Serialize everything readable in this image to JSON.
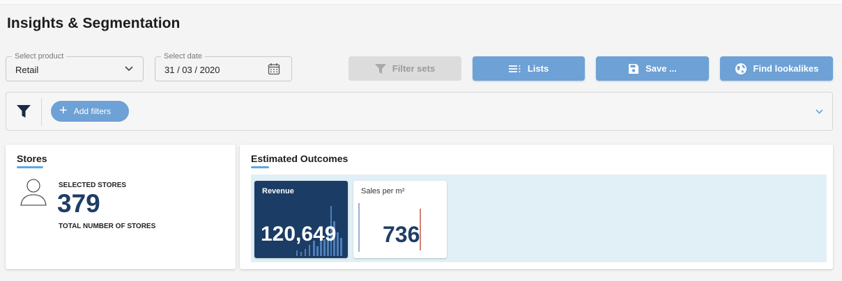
{
  "page": {
    "title": "Insights & Segmentation"
  },
  "controls": {
    "product": {
      "label": "Select product",
      "value": "Retail"
    },
    "date": {
      "label": "Select date",
      "value": "31 / 03 / 2020"
    }
  },
  "toolbar": {
    "filter_sets_label": "Filter sets",
    "lists_label": "Lists",
    "save_label": "Save ...",
    "find_lookalikes_label": "Find lookalikes"
  },
  "filters": {
    "add_label": "Add filters"
  },
  "stores": {
    "title": "Stores",
    "selected_label": "SELECTED STORES",
    "count": "379",
    "total_label": "TOTAL NUMBER OF STORES"
  },
  "outcomes": {
    "title": "Estimated Outcomes",
    "tiles": [
      {
        "label": "Revenue",
        "value": "120,649"
      },
      {
        "label": "Sales per m²",
        "value": "736"
      }
    ]
  },
  "icons": {
    "filter": "filter-icon",
    "calendar": "calendar-icon",
    "chevron": "chevron-down-icon",
    "list": "list-icon",
    "save": "save-icon",
    "globe": "globe-icon",
    "user": "user-icon",
    "plus": "plus-icon"
  },
  "colors": {
    "accent": "#6ea1d6",
    "dark_tile": "#1b3c64",
    "number": "#1e3d66",
    "underline": "#5aa9e6",
    "outcome_bg": "#e1eff6"
  }
}
